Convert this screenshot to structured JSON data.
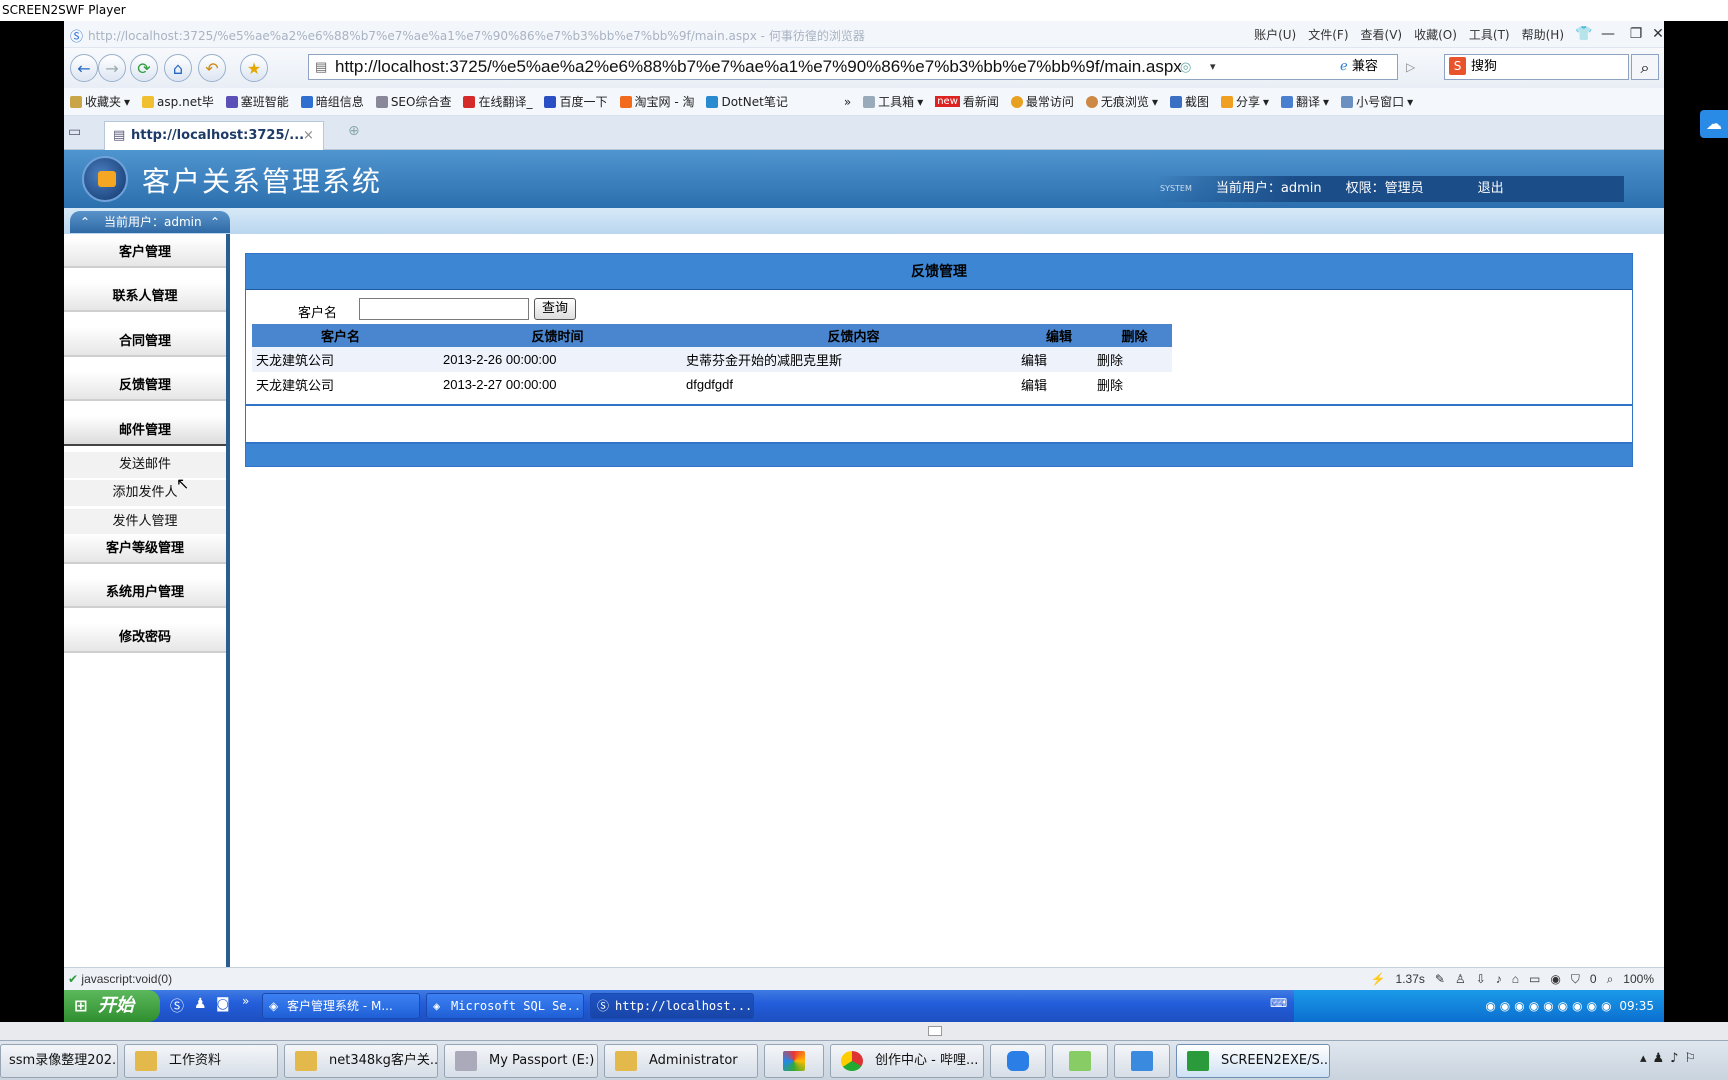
{
  "player": {
    "title": "SCREEN2SWF Player"
  },
  "browser": {
    "title_url": "http://localhost:3725/%e5%ae%a2%e6%88%b7%e7%ae%a1%e7%90%86%e7%b3%bb%e7%bb%9f/main.aspx - 何事彷徨的浏览器",
    "menu": [
      "账户(U)",
      "文件(F)",
      "查看(V)",
      "收藏(O)",
      "工具(T)",
      "帮助(H)"
    ],
    "address": "http://localhost:3725/%e5%ae%a2%e6%88%b7%e7%ae%a1%e7%90%86%e7%b3%bb%e7%bb%9f/main.aspx",
    "compat_label": "兼容",
    "search_placeholder": "搜狗",
    "favorites": [
      "收藏夹",
      "asp.net毕",
      "塞班智能",
      "暗组信息",
      "SEO综合查",
      "在线翻译_",
      "百度一下",
      "淘宝网 - 淘",
      "DotNet笔记"
    ],
    "toolbar_right": [
      "工具箱",
      "new",
      "看新闻",
      "最常访问",
      "无痕浏览",
      "截图",
      "分享",
      "翻译",
      "小号窗口"
    ],
    "tab_label": "http://localhost:3725/..."
  },
  "page": {
    "system_title": "客户关系管理系统",
    "banner_current_user": "当前用户：admin",
    "banner_permission": "权限：管理员",
    "banner_logout": "退出",
    "banner_system": "SYSTEM",
    "userbar_label": "当前用户：admin",
    "sidebar": {
      "customer": "客户管理",
      "contact": "联系人管理",
      "contract": "合同管理",
      "feedback": "反馈管理",
      "mail": "邮件管理",
      "mail_send": "发送邮件",
      "mail_add_sender": "添加发件人",
      "mail_sender_manage": "发件人管理",
      "level": "客户等级管理",
      "sysuser": "系统用户管理",
      "password": "修改密码"
    },
    "content": {
      "title": "反馈管理",
      "search_label": "客户名",
      "search_value": "",
      "query_label": "查询",
      "columns": [
        "客户名",
        "反馈时间",
        "反馈内容",
        "编辑",
        "删除"
      ],
      "rows": [
        {
          "customer": "天龙建筑公司",
          "time": "2013-2-26 00:00:00",
          "content": "史蒂芬金开始的减肥克里斯",
          "edit": "编辑",
          "delete": "删除"
        },
        {
          "customer": "天龙建筑公司",
          "time": "2013-2-27 00:00:00",
          "content": "dfgdfgdf",
          "edit": "编辑",
          "delete": "删除"
        }
      ]
    }
  },
  "statusbar": {
    "left": "javascript:void(0)",
    "time": "1.37s",
    "count": "0",
    "zoom": "100%"
  },
  "xp_taskbar": {
    "start": "开始",
    "tasks": [
      "客户管理系统 - M...",
      "Microsoft SQL Se...",
      "http://localhost..."
    ],
    "clock": "09:35"
  },
  "outer_taskbar": {
    "tasks": [
      "ssm录像整理202...",
      "工作资料",
      "net348kg客户关...",
      "My Passport (E:)",
      "Administrator",
      "创作中心 - 哔哩...",
      "SCREEN2EXE/S..."
    ]
  }
}
